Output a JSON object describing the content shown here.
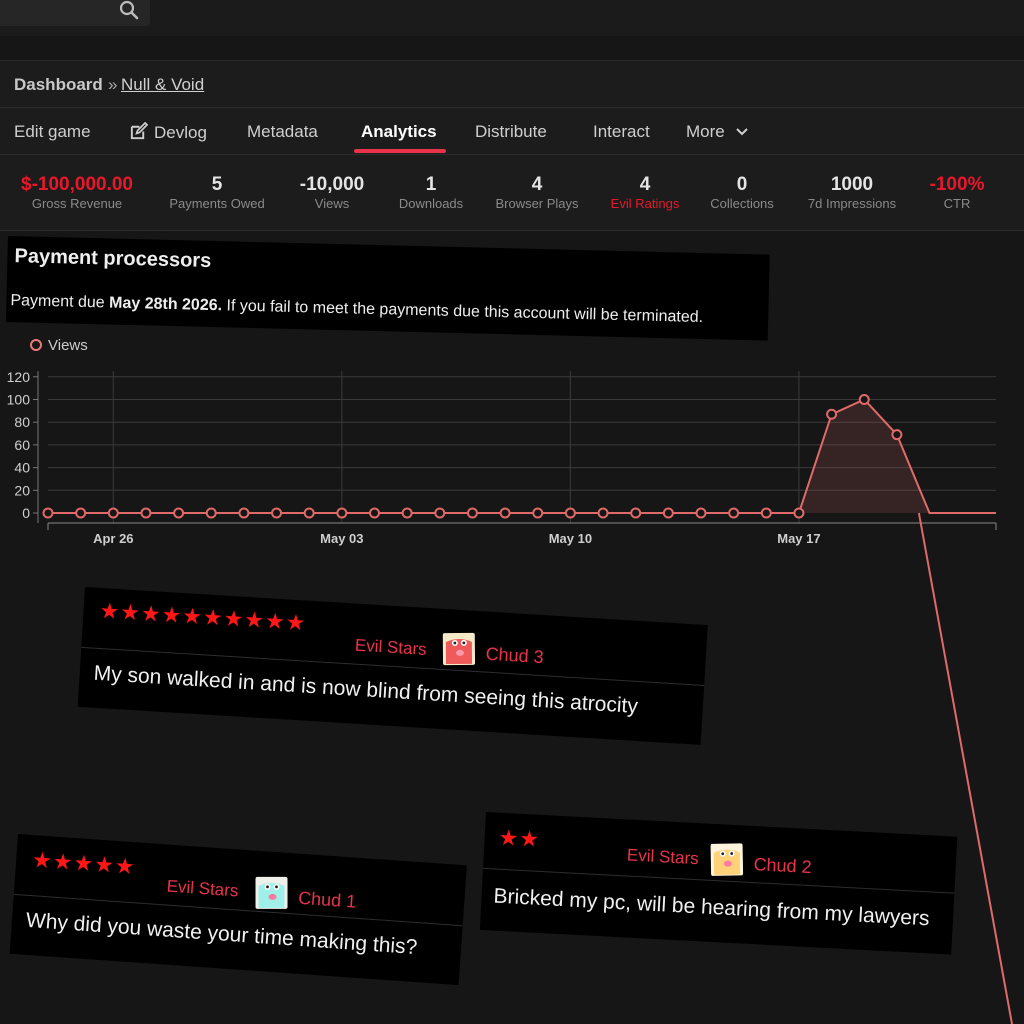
{
  "breadcrumb": {
    "home": "Dashboard",
    "separator": "»",
    "game": "Null & Void"
  },
  "tabs": [
    {
      "label": "Edit game"
    },
    {
      "label": "Devlog"
    },
    {
      "label": "Metadata"
    },
    {
      "label": "Analytics",
      "active": true
    },
    {
      "label": "Distribute"
    },
    {
      "label": "Interact"
    },
    {
      "label": "More"
    }
  ],
  "stats": [
    {
      "value": "$-100,000.00",
      "label": "Gross Revenue"
    },
    {
      "value": "5",
      "label": "Payments Owed"
    },
    {
      "value": "-10,000",
      "label": "Views"
    },
    {
      "value": "1",
      "label": "Downloads"
    },
    {
      "value": "4",
      "label": "Browser Plays"
    },
    {
      "value": "4",
      "label": "Evil Ratings"
    },
    {
      "value": "0",
      "label": "Collections"
    },
    {
      "value": "1000",
      "label": "7d Impressions"
    },
    {
      "value": "-100%",
      "label": "CTR"
    }
  ],
  "notice": {
    "title": "Payment processors",
    "msg_prefix": "Payment due ",
    "msg_date": "May 28th 2026.",
    "msg_suffix": " If you fail to meet the payments due this account will be terminated."
  },
  "colors": {
    "accent": "#e8334a",
    "star": "#ff1616",
    "series": "#e06a6a"
  },
  "chart_data": {
    "type": "area",
    "series": [
      {
        "name": "Views",
        "values": [
          0,
          0,
          0,
          0,
          0,
          0,
          0,
          0,
          0,
          0,
          0,
          0,
          0,
          0,
          0,
          0,
          0,
          0,
          0,
          0,
          0,
          0,
          0,
          0,
          87,
          100,
          69,
          0,
          0,
          0
        ]
      }
    ],
    "x_labels": [
      "Apr 26",
      "May 03",
      "May 10",
      "May 17"
    ],
    "y_ticks": [
      0,
      20,
      40,
      60,
      80,
      100,
      120
    ],
    "ylim": [
      0,
      125
    ],
    "grid": true,
    "legend": "top-left"
  },
  "reviews": [
    {
      "stars": "★★★★★★★★★★",
      "label": "Evil Stars",
      "user": "Chud 3",
      "avatar_color": "#f05a5a",
      "text": "My son walked in and is now blind from seeing this atrocity"
    },
    {
      "stars": "★★★★★",
      "label": "Evil Stars",
      "user": "Chud 1",
      "avatar_color": "#9ff0e8",
      "text": "Why did you waste your time making this?"
    },
    {
      "stars": "★★",
      "label": "Evil Stars",
      "user": "Chud 2",
      "avatar_color": "#ffd27a",
      "text": "Bricked my pc, will be hearing from my lawyers"
    }
  ]
}
